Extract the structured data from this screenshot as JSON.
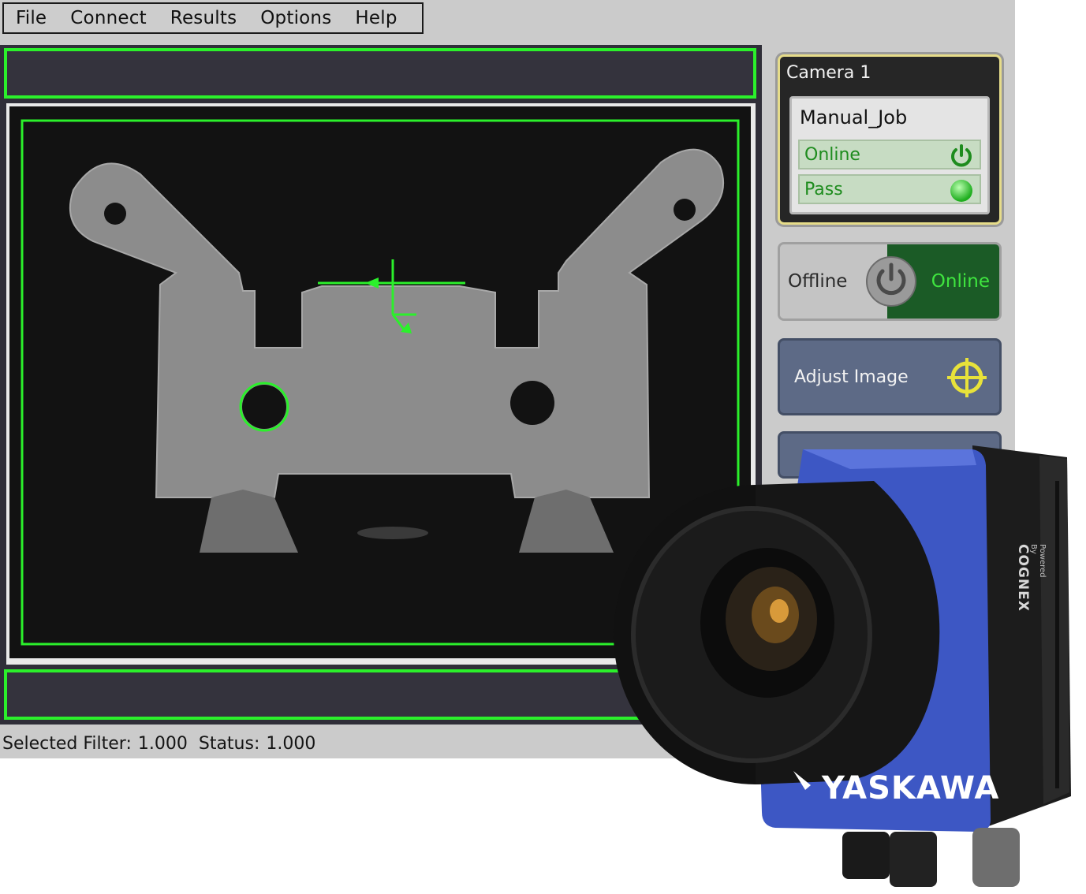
{
  "menu": {
    "items": [
      "File",
      "Connect",
      "Results",
      "Options",
      "Help"
    ]
  },
  "status": {
    "filter_label": "Selected Filter:",
    "filter_value": "1.000",
    "status_label": "Status:",
    "status_value": "1.000"
  },
  "side_panel": {
    "camera_title": "Camera 1",
    "job_name": "Manual_Job",
    "online_label": "Online",
    "pass_label": "Pass",
    "toggle_off_label": "Offline",
    "toggle_on_label": "Online",
    "adjust_label": "Adjust Image"
  },
  "camera_product": {
    "brand": "YASKAWA",
    "powered_by": "Powered By",
    "cognex": "COGNEX"
  },
  "colors": {
    "overlay_green": "#2bf02b",
    "panel_blue": "#5d6a86",
    "online_green": "#1b5b26",
    "camera_blue": "#3d57c4"
  }
}
